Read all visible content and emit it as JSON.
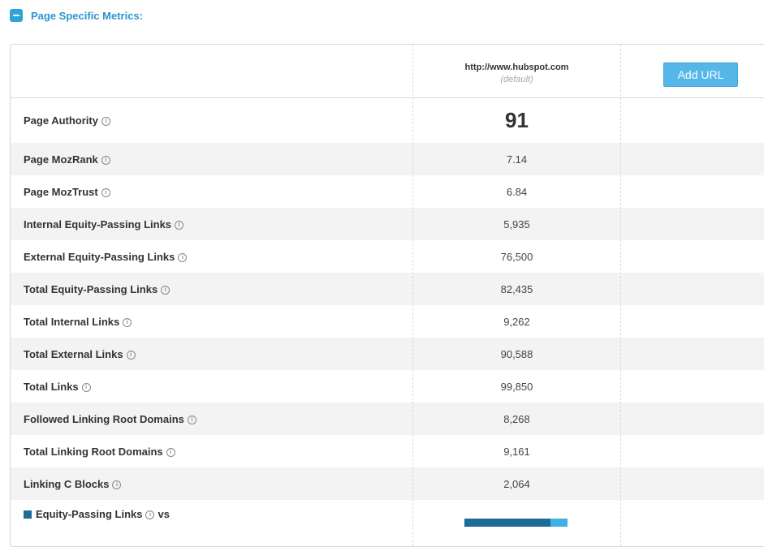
{
  "section": {
    "title": "Page Specific Metrics:"
  },
  "header": {
    "url": "http://www.hubspot.com",
    "url_note": "(default)",
    "add_url_label": "Add URL"
  },
  "metrics": [
    {
      "label": "Page Authority",
      "value": "91"
    },
    {
      "label": "Page MozRank",
      "value": "7.14"
    },
    {
      "label": "Page MozTrust",
      "value": "6.84"
    },
    {
      "label": "Internal Equity-Passing Links",
      "value": "5,935"
    },
    {
      "label": "External Equity-Passing Links",
      "value": "76,500"
    },
    {
      "label": "Total Equity-Passing Links",
      "value": "82,435"
    },
    {
      "label": "Total Internal Links",
      "value": "9,262"
    },
    {
      "label": "Total External Links",
      "value": "90,588"
    },
    {
      "label": "Total Links",
      "value": "99,850"
    },
    {
      "label": "Followed Linking Root Domains",
      "value": "8,268"
    },
    {
      "label": "Total Linking Root Domains",
      "value": "9,161"
    },
    {
      "label": "Linking C Blocks",
      "value": "2,064"
    }
  ],
  "partial": {
    "label": "Equity-Passing Links",
    "label_suffix": "vs"
  },
  "info_glyph": "i",
  "colors": {
    "accent": "#2d95cf",
    "button": "#55b7e8",
    "bar_dark": "#1e6b96",
    "bar_light": "#3fb0e4",
    "row_alt": "#f3f3f3"
  }
}
